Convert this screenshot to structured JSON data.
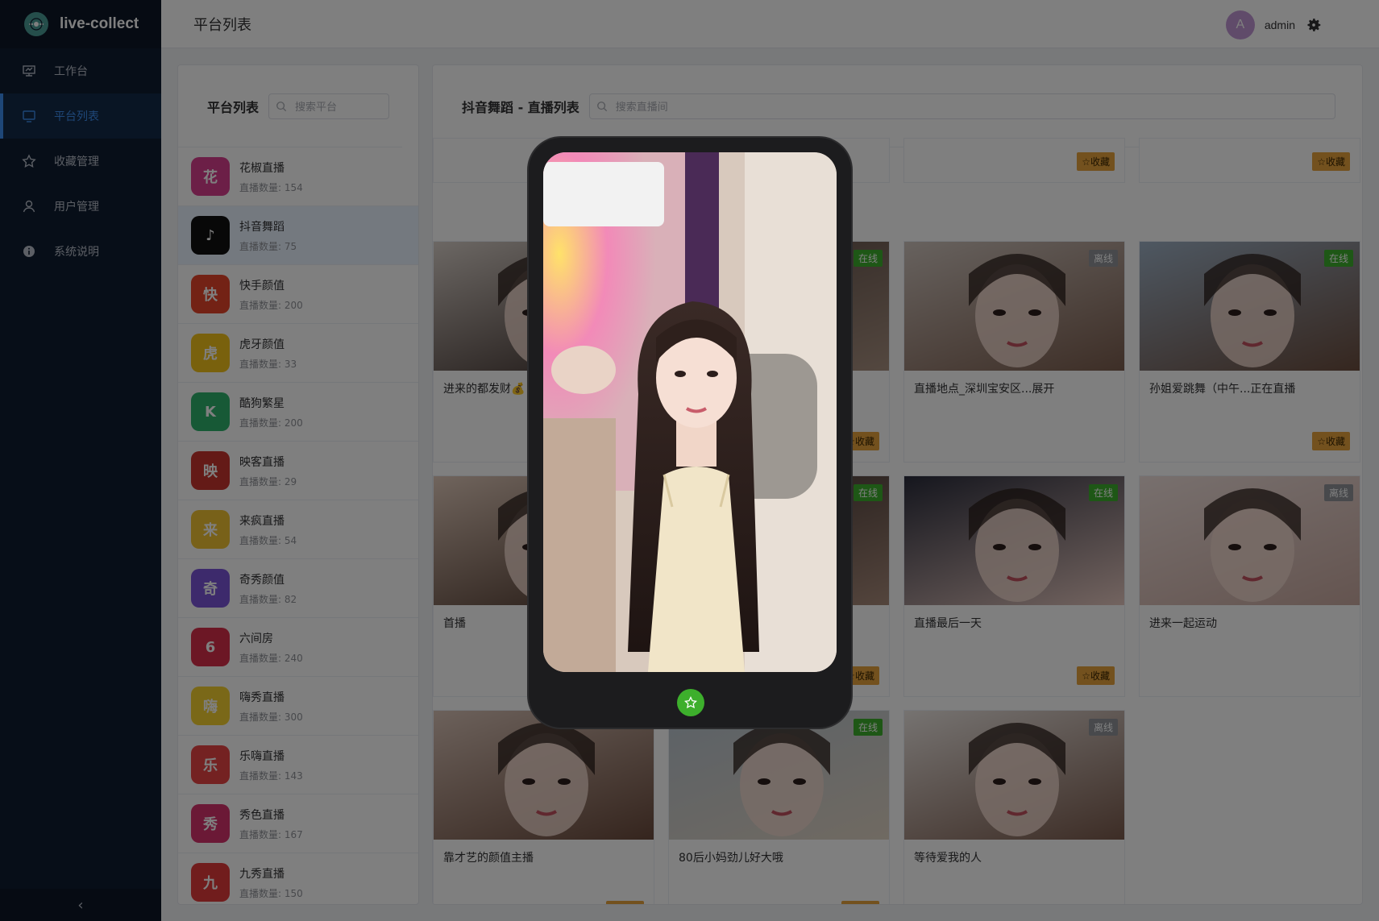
{
  "app": {
    "title": "live-collect"
  },
  "sidebar": {
    "items": [
      {
        "label": "工作台",
        "icon": "dashboard-icon",
        "active": false
      },
      {
        "label": "平台列表",
        "icon": "monitor-icon",
        "active": true
      },
      {
        "label": "收藏管理",
        "icon": "star-icon",
        "active": false
      },
      {
        "label": "用户管理",
        "icon": "user-icon",
        "active": false
      },
      {
        "label": "系统说明",
        "icon": "info-icon",
        "active": false
      }
    ],
    "collapse_glyph": "‹"
  },
  "header": {
    "title": "平台列表",
    "avatar_letter": "A",
    "username": "admin"
  },
  "platform_panel": {
    "title": "平台列表",
    "search_placeholder": "搜索平台",
    "items": [
      {
        "name": "花椒直播",
        "count": "直播数量: 154",
        "color": "#d83f8f",
        "glyph": "花"
      },
      {
        "name": "抖音舞蹈",
        "count": "直播数量: 75",
        "color": "#111111",
        "glyph": "♪"
      },
      {
        "name": "快手颜值",
        "count": "直播数量: 200",
        "color": "#e6452a",
        "glyph": "快"
      },
      {
        "name": "虎牙颜值",
        "count": "直播数量: 33",
        "color": "#f2c21b",
        "glyph": "虎"
      },
      {
        "name": "酷狗繁星",
        "count": "直播数量: 200",
        "color": "#2fb36d",
        "glyph": "K"
      },
      {
        "name": "映客直播",
        "count": "直播数量: 29",
        "color": "#c9352e",
        "glyph": "映"
      },
      {
        "name": "来疯直播",
        "count": "直播数量: 54",
        "color": "#f1c232",
        "glyph": "来"
      },
      {
        "name": "奇秀颜值",
        "count": "直播数量: 82",
        "color": "#7b55d9",
        "glyph": "奇"
      },
      {
        "name": "六间房",
        "count": "直播数量: 240",
        "color": "#d92f4a",
        "glyph": "6"
      },
      {
        "name": "嗨秀直播",
        "count": "直播数量: 300",
        "color": "#f5d131",
        "glyph": "嗨"
      },
      {
        "name": "乐嗨直播",
        "count": "直播数量: 143",
        "color": "#e84444",
        "glyph": "乐"
      },
      {
        "name": "秀色直播",
        "count": "直播数量: 167",
        "color": "#d6336c",
        "glyph": "秀"
      },
      {
        "name": "九秀直播",
        "count": "直播数量: 150",
        "color": "#e23a3a",
        "glyph": "九"
      }
    ]
  },
  "stream_panel": {
    "title": "抖音舞蹈 - 直播列表",
    "search_placeholder": "搜索直播间",
    "fav_label": "☆收藏",
    "status_online": "在线",
    "status_offline": "离线",
    "cards": [
      {
        "title": "",
        "status": "",
        "fav": false,
        "img": [
          "#c9c9c9",
          "#e2e2e2"
        ]
      },
      {
        "title": "",
        "status": "",
        "fav": false,
        "img": [
          "#c9c9c9",
          "#e2e2e2"
        ]
      },
      {
        "title": "",
        "status": "",
        "fav": true,
        "img": [
          "#c9c9c9",
          "#e2e2e2"
        ]
      },
      {
        "title": "",
        "status": "",
        "fav": true,
        "img": [
          "#c9c9c9",
          "#e2e2e2"
        ]
      },
      {
        "title": "进来的都发财💰",
        "status": "",
        "fav": false,
        "img": [
          "#d8cfc8",
          "#3a2c28"
        ]
      },
      {
        "title": "",
        "status": "on",
        "fav": true,
        "img": [
          "#5a4a44",
          "#a89080"
        ]
      },
      {
        "title": "直播地点_深圳宝安区...展开",
        "status": "off",
        "fav": false,
        "img": [
          "#cfc4bd",
          "#7b5d4e"
        ]
      },
      {
        "title": "孙姐爱跳舞（中午...正在直播",
        "status": "on",
        "fav": true,
        "img": [
          "#9db0c4",
          "#6b4d3e"
        ]
      },
      {
        "title": "首播",
        "status": "",
        "fav": false,
        "img": [
          "#e0c9ba",
          "#4a3328"
        ]
      },
      {
        "title": "",
        "status": "on",
        "fav": true,
        "img": [
          "#3a2e2c",
          "#a88a7a"
        ]
      },
      {
        "title": "直播最后一天",
        "status": "on",
        "fav": true,
        "img": [
          "#2b2d3c",
          "#e6c8c0"
        ]
      },
      {
        "title": "进来一起运动",
        "status": "off",
        "fav": false,
        "img": [
          "#f0e0dc",
          "#c9a9a0"
        ]
      },
      {
        "title": "靠才艺的颜值主播",
        "status": "",
        "fav": true,
        "img": [
          "#d8c2b6",
          "#6a4a3c"
        ]
      },
      {
        "title": "80后小妈劲儿好大哦",
        "status": "on",
        "fav": true,
        "img": [
          "#b8c4cf",
          "#e0d4c4"
        ]
      },
      {
        "title": "等待爱我的人",
        "status": "off",
        "fav": false,
        "img": [
          "#ece6e2",
          "#7a5a4c"
        ]
      }
    ]
  },
  "player": {
    "fav_icon": "star-icon"
  },
  "colors": {
    "sidebar": "#0f1c30",
    "accent": "#3d8ef0",
    "online": "#3daf2c",
    "offline": "#909399",
    "fav": "#e6a23c"
  }
}
